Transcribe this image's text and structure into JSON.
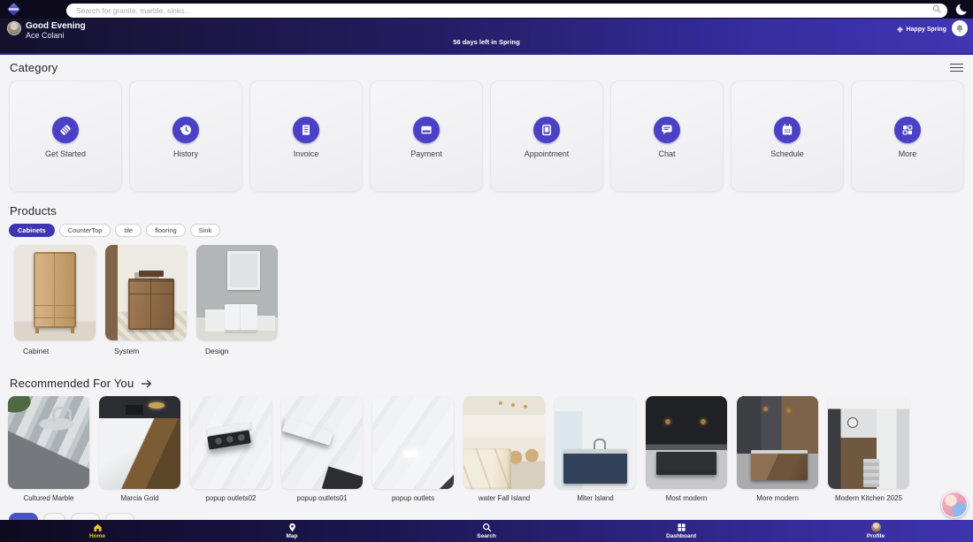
{
  "topbar": {
    "search_placeholder": "Search for granite, marble, sinks..."
  },
  "header": {
    "greeting": "Good Evening",
    "user_name": "Ace Colani",
    "days_left": "56 days left in Spring",
    "season_badge": "Happy Spring"
  },
  "category": {
    "title": "Category",
    "items": [
      {
        "label": "Get Started",
        "icon": "handshake-icon"
      },
      {
        "label": "History",
        "icon": "history-clock-icon"
      },
      {
        "label": "Invoice",
        "icon": "receipt-icon"
      },
      {
        "label": "Payment",
        "icon": "credit-card-icon"
      },
      {
        "label": "Appointment",
        "icon": "tablet-calendar-icon"
      },
      {
        "label": "Chat",
        "icon": "chat-bubble-icon"
      },
      {
        "label": "Schedule",
        "icon": "calendar-grid-icon"
      },
      {
        "label": "More",
        "icon": "grid-more-icon"
      }
    ]
  },
  "products": {
    "title": "Products",
    "filters": [
      {
        "label": "Cabinets",
        "active": true
      },
      {
        "label": "CounterTop",
        "active": false
      },
      {
        "label": "tile",
        "active": false
      },
      {
        "label": "flooring",
        "active": false
      },
      {
        "label": "Sink",
        "active": false
      }
    ],
    "items": [
      {
        "label": "Cabinet"
      },
      {
        "label": "System"
      },
      {
        "label": "Design"
      }
    ]
  },
  "recommended": {
    "title": "Recommended For You",
    "items": [
      {
        "label": "Cultured Marble"
      },
      {
        "label": "Marcia Gold"
      },
      {
        "label": "popup outlets02"
      },
      {
        "label": "popup outlets01"
      },
      {
        "label": "popup outlets"
      },
      {
        "label": "water Fall Island"
      },
      {
        "label": "Miter Island"
      },
      {
        "label": "Most modern"
      },
      {
        "label": "More modern"
      },
      {
        "label": "Modern Kitchen 2025"
      }
    ]
  },
  "bottom_nav": {
    "items": [
      {
        "label": "Home",
        "icon": "home-icon",
        "active": true
      },
      {
        "label": "Map",
        "icon": "map-pin-icon",
        "active": false
      },
      {
        "label": "Search",
        "icon": "search-icon",
        "active": false
      },
      {
        "label": "Dashboard",
        "icon": "dashboard-grid-icon",
        "active": false
      },
      {
        "label": "Profile",
        "icon": "profile-avatar",
        "active": false
      }
    ]
  },
  "colors": {
    "accent_indigo": "#4a41c6",
    "active_filter": "#3d35b1",
    "header_gradient_start": "#14112c",
    "header_gradient_end": "#4036b2",
    "active_nav_yellow": "#f0c61c",
    "page_background": "#f4f3f5"
  }
}
